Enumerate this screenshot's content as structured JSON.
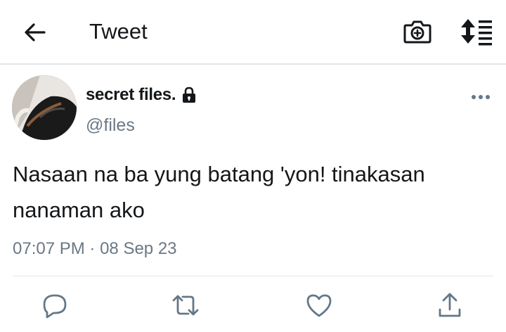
{
  "header": {
    "title": "Tweet",
    "icons": {
      "back": "arrow-left-icon",
      "camera": "camera-add-icon",
      "sort": "sort-list-icon"
    }
  },
  "tweet": {
    "display_name": "secret files.",
    "protected": true,
    "handle": "@files",
    "text": "Nasaan na ba yung batang 'yon! tinakasan nanaman ako",
    "time": "07:07 PM",
    "separator": "·",
    "date": "08 Sep 23"
  },
  "actions": [
    "reply-icon",
    "retweet-icon",
    "like-icon",
    "share-icon"
  ],
  "colors": {
    "text": "#14171a",
    "secondary": "#6b7884",
    "icon": "#657786",
    "divider": "#e1e6ea"
  }
}
